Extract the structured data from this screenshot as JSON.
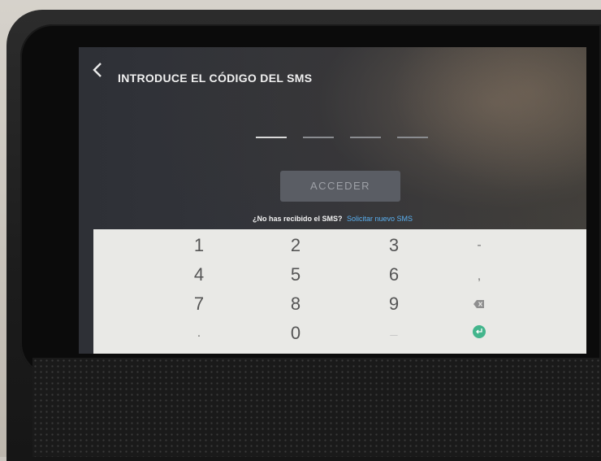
{
  "header": {
    "back_icon": "chevron-left-icon",
    "title": "INTRODUCE EL CÓDIGO DEL SMS"
  },
  "code_input": {
    "slots": 4,
    "filled": 0
  },
  "actions": {
    "access_label": "ACCEDER"
  },
  "resend": {
    "prompt": "¿No has recibido el SMS?",
    "link": "Solicitar nuevo SMS"
  },
  "keypad": {
    "keys": {
      "k1": "1",
      "k2": "2",
      "k3": "3",
      "minus": "-",
      "k4": "4",
      "k5": "5",
      "k6": "6",
      "comma": ",",
      "k7": "7",
      "k8": "8",
      "k9": "9",
      "backspace": "backspace-icon",
      "period": ".",
      "k0": "0",
      "underscore": "_",
      "enter": "enter-icon"
    }
  },
  "colors": {
    "link": "#5ab0f0",
    "button_bg": "#5a5d64",
    "keypad_bg": "#e9e9e6",
    "enter_key": "#43b58c"
  }
}
